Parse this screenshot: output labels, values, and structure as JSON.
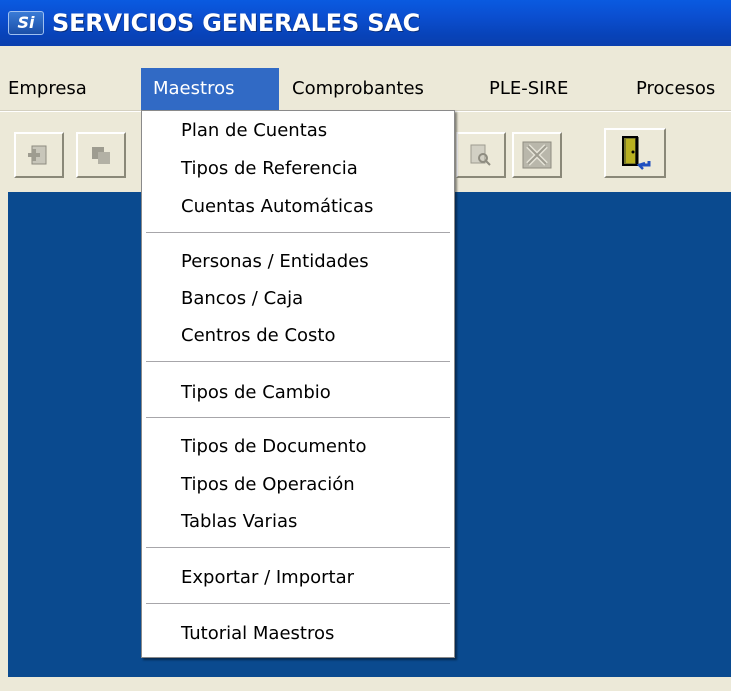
{
  "window": {
    "logo_text": "Si",
    "title": "SERVICIOS GENERALES SAC"
  },
  "menubar": {
    "items": [
      {
        "label": "Empresa"
      },
      {
        "label": "Maestros"
      },
      {
        "label": "Comprobantes"
      },
      {
        "label": "PLE-SIRE"
      },
      {
        "label": "Procesos"
      }
    ],
    "active": "Maestros"
  },
  "toolbar": {
    "buttons": [
      {
        "icon": "add-document-icon"
      },
      {
        "icon": "copy-pages-icon"
      },
      {
        "icon": "print-preview-icon"
      },
      {
        "icon": "excel-export-icon"
      },
      {
        "icon": "exit-door-icon"
      }
    ]
  },
  "dropdown": {
    "items": [
      {
        "label": "Plan de Cuentas"
      },
      {
        "label": "Tipos de Referencia"
      },
      {
        "label": "Cuentas Automáticas"
      },
      {
        "label": "Personas / Entidades"
      },
      {
        "label": "Bancos / Caja"
      },
      {
        "label": "Centros de Costo"
      },
      {
        "label": "Tipos de Cambio"
      },
      {
        "label": "Tipos de Documento"
      },
      {
        "label": "Tipos de Operación"
      },
      {
        "label": "Tablas Varias"
      },
      {
        "label": "Exportar / Importar"
      },
      {
        "label": "Tutorial Maestros"
      }
    ]
  },
  "colors": {
    "titlebar": "#0a4fd1",
    "menu_highlight": "#316ac5",
    "desktop": "#0a4a8f",
    "chrome": "#ece9d8"
  }
}
